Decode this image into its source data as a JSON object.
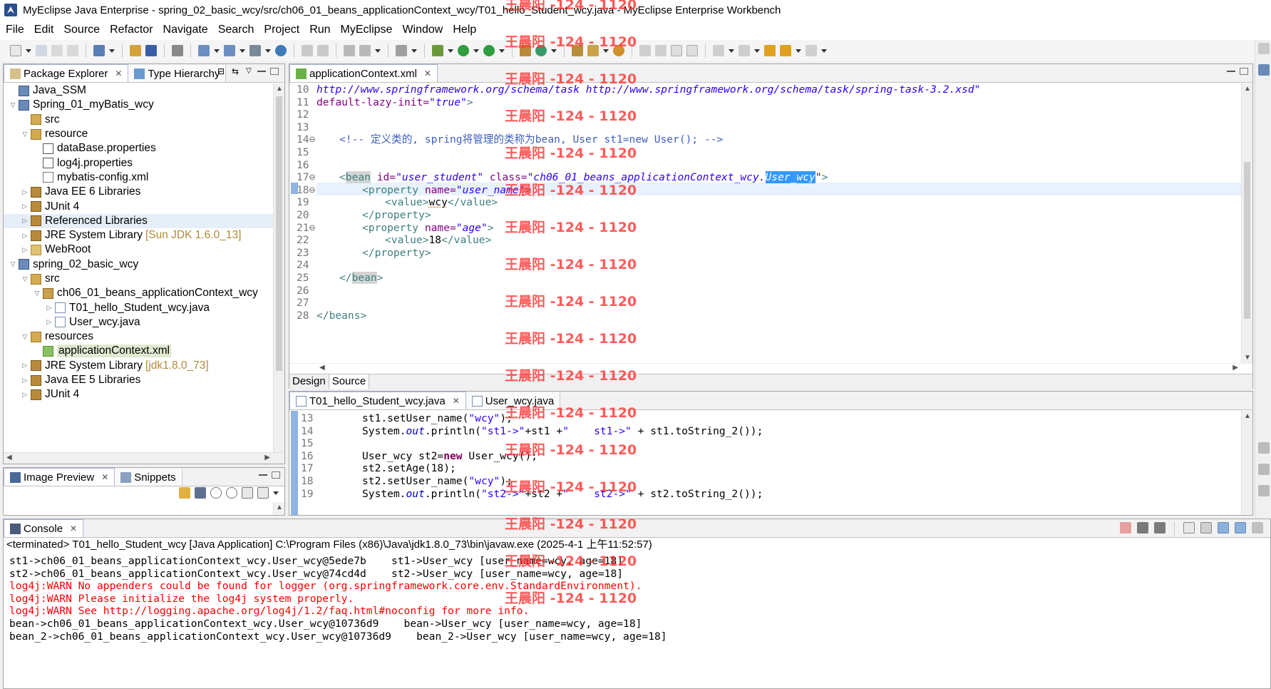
{
  "window": {
    "title": "MyEclipse Java Enterprise - spring_02_basic_wcy/src/ch06_01_beans_applicationContext_wcy/T01_hello_Student_wcy.java - MyEclipse Enterprise Workbench"
  },
  "menu": [
    "File",
    "Edit",
    "Source",
    "Refactor",
    "Navigate",
    "Search",
    "Project",
    "Run",
    "MyEclipse",
    "Window",
    "Help"
  ],
  "package_explorer": {
    "tabs": [
      "Package Explorer",
      "Type Hierarchy"
    ],
    "tree": [
      {
        "label": "Java_SSM",
        "icon": "project-icon",
        "level": 0,
        "twisty": ""
      },
      {
        "label": "Spring_01_myBatis_wcy",
        "icon": "project-icon",
        "level": 0,
        "twisty": "▽"
      },
      {
        "label": "src",
        "icon": "source-folder-icon",
        "level": 1,
        "twisty": ""
      },
      {
        "label": "resource",
        "icon": "source-folder-icon",
        "level": 1,
        "twisty": "▽"
      },
      {
        "label": "dataBase.properties",
        "icon": "properties-file-icon",
        "level": 2,
        "twisty": ""
      },
      {
        "label": "log4j.properties",
        "icon": "properties-file-icon",
        "level": 2,
        "twisty": ""
      },
      {
        "label": "mybatis-config.xml",
        "icon": "xml-file-icon",
        "level": 2,
        "twisty": ""
      },
      {
        "label": "Java EE 6 Libraries",
        "icon": "library-icon",
        "level": 1,
        "twisty": "▷"
      },
      {
        "label": "JUnit 4",
        "icon": "library-icon",
        "level": 1,
        "twisty": "▷"
      },
      {
        "label": "Referenced Libraries",
        "icon": "library-icon",
        "level": 1,
        "twisty": "▷",
        "highlight": true
      },
      {
        "label": "JRE System Library",
        "deco": "[Sun JDK 1.6.0_13]",
        "icon": "library-icon",
        "level": 1,
        "twisty": "▷"
      },
      {
        "label": "WebRoot",
        "icon": "folder-icon",
        "level": 1,
        "twisty": "▷"
      },
      {
        "label": "spring_02_basic_wcy",
        "icon": "project-icon",
        "level": 0,
        "twisty": "▽"
      },
      {
        "label": "src",
        "icon": "source-folder-icon",
        "level": 1,
        "twisty": "▽"
      },
      {
        "label": "ch06_01_beans_applicationContext_wcy",
        "icon": "package-icon",
        "level": 2,
        "twisty": "▽"
      },
      {
        "label": "T01_hello_Student_wcy.java",
        "icon": "java-file-icon",
        "level": 3,
        "twisty": "▷"
      },
      {
        "label": "User_wcy.java",
        "icon": "java-file-icon",
        "level": 3,
        "twisty": "▷"
      },
      {
        "label": "resources",
        "icon": "source-folder-icon",
        "level": 1,
        "twisty": "▽"
      },
      {
        "label": "applicationContext.xml",
        "icon": "spring-xml-icon",
        "level": 2,
        "twisty": "",
        "selected": true
      },
      {
        "label": "JRE System Library",
        "deco": "[jdk1.8.0_73]",
        "icon": "library-icon",
        "level": 1,
        "twisty": "▷"
      },
      {
        "label": "Java EE 5 Libraries",
        "icon": "library-icon",
        "level": 1,
        "twisty": "▷"
      },
      {
        "label": "JUnit 4",
        "icon": "library-icon",
        "level": 1,
        "twisty": "▷"
      }
    ]
  },
  "image_preview": {
    "tabs": [
      "Image Preview",
      "Snippets"
    ]
  },
  "xml_editor": {
    "tab": "applicationContext.xml",
    "bottom_tabs": [
      "Design",
      "Source"
    ],
    "line_numbers": [
      "10",
      "11",
      "12",
      "13",
      "14⊖",
      "15",
      "16",
      "17⊖",
      "18⊖",
      "19",
      "20",
      "21⊖",
      "22",
      "23",
      "24",
      "25",
      "26",
      "27",
      "28"
    ],
    "lines": {
      "l10": "http://www.springframework.org/schema/task http://www.springframework.org/schema/task/spring-task-3.2.xsd\"",
      "l11a": "default-lazy-init=",
      "l11b": "\"true\"",
      "l11c": ">",
      "l14": "<!-- 定义类的, spring将管理的类称为bean, User st1=new User(); -->",
      "l17a": "<",
      "l17b": "bean",
      "l17c": " id=",
      "l17d": "\"user_student\"",
      "l17e": " class=",
      "l17f": "\"ch06_01_beans_applicationContext_wcy.",
      "l17g": "User_wcy",
      "l17h": "\"",
      "l17i": ">",
      "l18a": "<property",
      "l18b": " name=",
      "l18c": "\"user_name\"",
      "l18d": ">",
      "l19a": "<value>",
      "l19b": "wcy",
      "l19c": "</value>",
      "l20": "</property>",
      "l21a": "<property",
      "l21b": " name=",
      "l21c": "\"age\"",
      "l21d": ">",
      "l22a": "<value>",
      "l22b": "18",
      "l22c": "</value>",
      "l23": "</property>",
      "l25a": "</",
      "l25b": "bean",
      "l25c": ">",
      "l28": "</beans>"
    }
  },
  "java_editor": {
    "tabs": [
      "T01_hello_Student_wcy.java",
      "User_wcy.java"
    ],
    "line_numbers": [
      "13",
      "14",
      "15",
      "16",
      "17",
      "18",
      "19"
    ],
    "lines": {
      "l13a": "st1.setUser_name(",
      "l13b": "\"wcy\"",
      "l13c": ");",
      "l14a": "System.",
      "l14b": "out",
      "l14c": ".println(",
      "l14d": "\"st1->\"",
      "l14e": "+st1 +",
      "l14f": "\"    st1->\"",
      "l14g": " + st1.toString_2());",
      "l16a": "User_wcy st2=",
      "l16b": "new",
      "l16c": " User_wcy();",
      "l17": "st2.setAge(18);",
      "l18a": "st2.setUser_name(",
      "l18b": "\"wcy\"",
      "l18c": ");",
      "l19a": "System.",
      "l19b": "out",
      "l19c": ".println(",
      "l19d": "\"st2->\"",
      "l19e": "+st2 +",
      "l19f": "\"    st2->\"",
      "l19g": " + st2.toString_2());"
    }
  },
  "console": {
    "tab": "Console",
    "header": "<terminated> T01_hello_Student_wcy [Java Application] C:\\Program Files (x86)\\Java\\jdk1.8.0_73\\bin\\javaw.exe (2025-4-1 上午11:52:57)",
    "lines": [
      {
        "text": "st1->ch06_01_beans_applicationContext_wcy.User_wcy@5ede7b    st1->User_wcy [user_name=wcy, age=18]",
        "err": false
      },
      {
        "text": "st2->ch06_01_beans_applicationContext_wcy.User_wcy@74cd4d    st2->User_wcy [user_name=wcy, age=18]",
        "err": false
      },
      {
        "text": "log4j:WARN No appenders could be found for logger (org.springframework.core.env.StandardEnvironment).",
        "err": true
      },
      {
        "text": "log4j:WARN Please initialize the log4j system properly.",
        "err": true
      },
      {
        "text": "log4j:WARN See http://logging.apache.org/log4j/1.2/faq.html#noconfig for more info.",
        "err": true
      },
      {
        "text": "bean->ch06_01_beans_applicationContext_wcy.User_wcy@10736d9    bean->User_wcy [user_name=wcy, age=18]",
        "err": false
      },
      {
        "text": "bean_2->ch06_01_beans_applicationContext_wcy.User_wcy@10736d9    bean_2->User_wcy [user_name=wcy, age=18]",
        "err": false
      }
    ]
  },
  "watermark": "王晨阳 -124 - 1120"
}
